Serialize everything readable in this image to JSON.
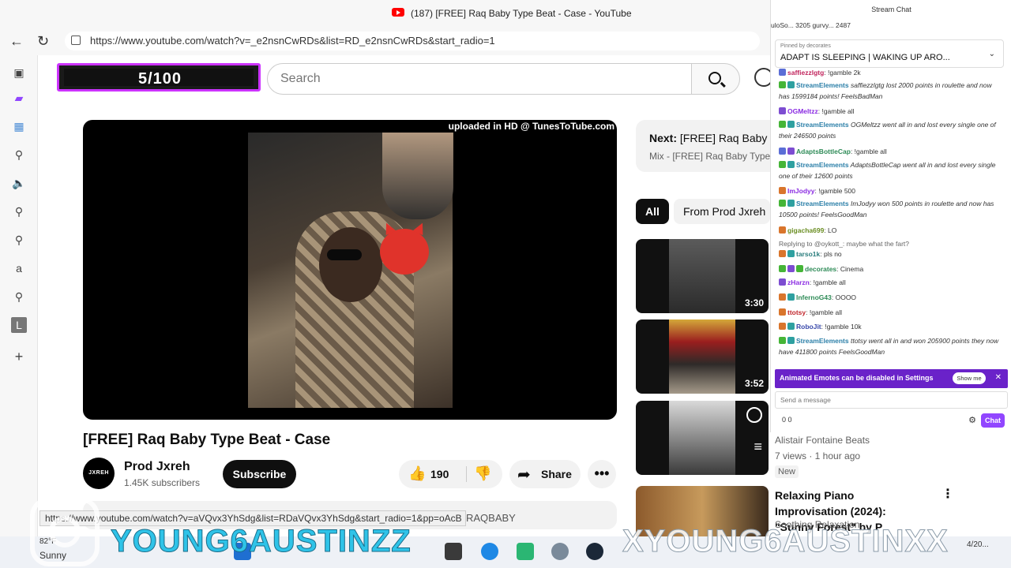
{
  "browser": {
    "tab_title": "(187) [FREE] Raq Baby Type Beat - Case - YouTube",
    "url": "https://www.youtube.com/watch?v=_e2nsnCwRDs&list=RD_e2nsnCwRDs&start_radio=1",
    "back_icon": "arrow-left-icon",
    "refresh_icon": "refresh-icon"
  },
  "overlay": {
    "stream_counter": "5/100",
    "left_name": "YOUNG6AUSTINZZ",
    "right_name": "XYOUNG6AUSTINXX"
  },
  "youtube": {
    "search_placeholder": "Search",
    "video": {
      "watermark": "uploaded in HD @ TunesToTube.com",
      "title": "[FREE] Raq Baby Type Beat - Case"
    },
    "channel": {
      "avatar_text": "JXREH",
      "name": "Prod Jxreh",
      "subscribers": "1.45K subscribers"
    },
    "actions": {
      "subscribe": "Subscribe",
      "likes": "190",
      "share": "Share",
      "more": "•••"
    },
    "description_hashtag": "RAQBABY",
    "hover_url": "https://www.youtube.com/watch?v=aVQvx3YhSdg&list=RDaVQvx3YhSdg&start_radio=1&pp=oAcB",
    "next": {
      "label": "Next:",
      "title": "[FREE] Raq Baby Ty",
      "subtitle": "Mix - [FREE] Raq Baby Type B"
    },
    "chips": [
      "All",
      "From Prod Jxreh"
    ],
    "recommendations": [
      {
        "duration": "3:30"
      },
      {
        "duration": "3:52"
      },
      {
        "duration": ""
      }
    ],
    "rec_side": {
      "channel": "Alistair Fontaine Beats",
      "meta": "7 views · 1 hour ago",
      "badge": "New",
      "title": "Relaxing Piano Improvisation (2024): \"Sunny Forest\" by P",
      "channel2": "Soothing Relaxation"
    }
  },
  "chat": {
    "header": "Stream Chat",
    "viewers": "uloSo... 3205   gurvy... 2487",
    "pinned_by": "Pinned by decorates",
    "pinned_msg": "ADAPT IS SLEEPING | WAKING UP ARO...",
    "messages": [
      {
        "user": "saffiezzlgtg",
        "text": ": !gamble 2k",
        "color": "u-pink",
        "badges": [
          "b-blue"
        ]
      },
      {
        "user": "StreamElements",
        "text": " saffiezzlgtg lost 2000 points in roulette and now has 1599184 points! FeelsBadMan",
        "color": "u-se",
        "badges": [
          "b-green",
          "b-teal"
        ],
        "italic": true
      },
      {
        "user": "OGMeltzz",
        "text": ": !gamble all",
        "color": "u-purple",
        "badges": [
          "b-purple"
        ]
      },
      {
        "user": "StreamElements",
        "text": " OGMeltzz went all in and lost every single one of their 246500 points",
        "color": "u-se",
        "badges": [
          "b-green",
          "b-teal"
        ],
        "italic": true
      },
      {
        "user": "AdaptsBottleCap",
        "text": ": !gamble all",
        "color": "u-green",
        "badges": [
          "b-blue",
          "b-purple"
        ]
      },
      {
        "user": "StreamElements",
        "text": " AdaptsBottleCap went all in and lost every single one of their 12600 points",
        "color": "u-se",
        "badges": [
          "b-green",
          "b-teal"
        ],
        "italic": true
      },
      {
        "user": "ImJodyy",
        "text": ": !gamble 500",
        "color": "u-purple",
        "badges": [
          "b-orange"
        ]
      },
      {
        "user": "StreamElements",
        "text": " ImJodyy won 500 points in roulette and now has 10500 points! FeelsGoodMan",
        "color": "u-se",
        "badges": [
          "b-green",
          "b-teal"
        ],
        "italic": true
      },
      {
        "user": "gigacha699",
        "text": ": LO",
        "color": "u-olive",
        "badges": [
          "b-orange"
        ]
      },
      {
        "user": "",
        "text": "Replying to @oykott_: maybe what the fart?",
        "color": "",
        "badges": []
      },
      {
        "user": "tarso1k",
        "text": ": pls no",
        "color": "u-teal",
        "badges": [
          "b-orange",
          "b-teal"
        ]
      },
      {
        "user": "decorates",
        "text": ": Cinema",
        "color": "u-green",
        "badges": [
          "b-green",
          "b-purple",
          "b-green"
        ]
      },
      {
        "user": "zHarzn",
        "text": ": !gamble all",
        "color": "u-purple",
        "badges": [
          "b-purple"
        ]
      },
      {
        "user": "InfernoG43",
        "text": ": OOOO",
        "color": "u-green",
        "badges": [
          "b-orange",
          "b-teal"
        ]
      },
      {
        "user": "ttotsy",
        "text": ": !gamble all",
        "color": "u-red",
        "badges": [
          "b-orange"
        ]
      },
      {
        "user": "RoboJit",
        "text": ": !gamble 10k",
        "color": "u-navy",
        "badges": [
          "b-orange",
          "b-teal"
        ]
      },
      {
        "user": "StreamElements",
        "text": " ttotsy went all in and won 205900 points they now have 411800 points FeelsGoodMan",
        "color": "u-se",
        "badges": [
          "b-green",
          "b-teal"
        ],
        "italic": true
      }
    ],
    "emote_banner": "Animated Emotes can be disabled in Settings",
    "show_me": "Show me",
    "send_placeholder": "Send a message",
    "points": "0   0",
    "chat_button": "Chat"
  },
  "taskbar": {
    "temp": "82°F",
    "condition": "Sunny",
    "clock": "4/20..."
  }
}
